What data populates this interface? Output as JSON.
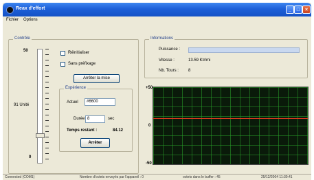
{
  "window": {
    "title": "Reax d'effort"
  },
  "menu": [
    "Fichier",
    "Options"
  ],
  "control_group": {
    "title": "Contrôle",
    "slider_max": "50",
    "slider_mid": "91 Unité",
    "slider_min": "0",
    "checkbox_reset": "Réinitialiser",
    "checkbox_raw": "Sans préfixage",
    "button_stop": "Arrêter la mise",
    "experience_title": "Expérience",
    "label_actuel": "Actuel",
    "value_actuel": "#6600",
    "label_durée": "Durée",
    "value_durée": "8",
    "unit_durée": "sec",
    "label_temps": "Temps restant :",
    "value_temps": "84.12",
    "button_arreter": "Arrêter"
  },
  "info_group": {
    "title": "Informations",
    "label_puissance": "Puissance :",
    "label_vitesse": "Vitesse :",
    "value_vitesse": "13.59 Ktr/mi",
    "label_tours": "Nb. Tours :",
    "value_tours": "8"
  },
  "scope": {
    "top_label": "+50",
    "mid_label": "0",
    "bottom_label": "-50",
    "trace_color": "#d43a1f",
    "grid_color": "#28a028"
  },
  "status": {
    "connection": "Connected (COM1)",
    "message": "Nombre d'octets envoyés par l'appareil : 0",
    "buffer": "octets dans le buffer : 45",
    "timestamp": "25/12/2004 11:30:41"
  }
}
